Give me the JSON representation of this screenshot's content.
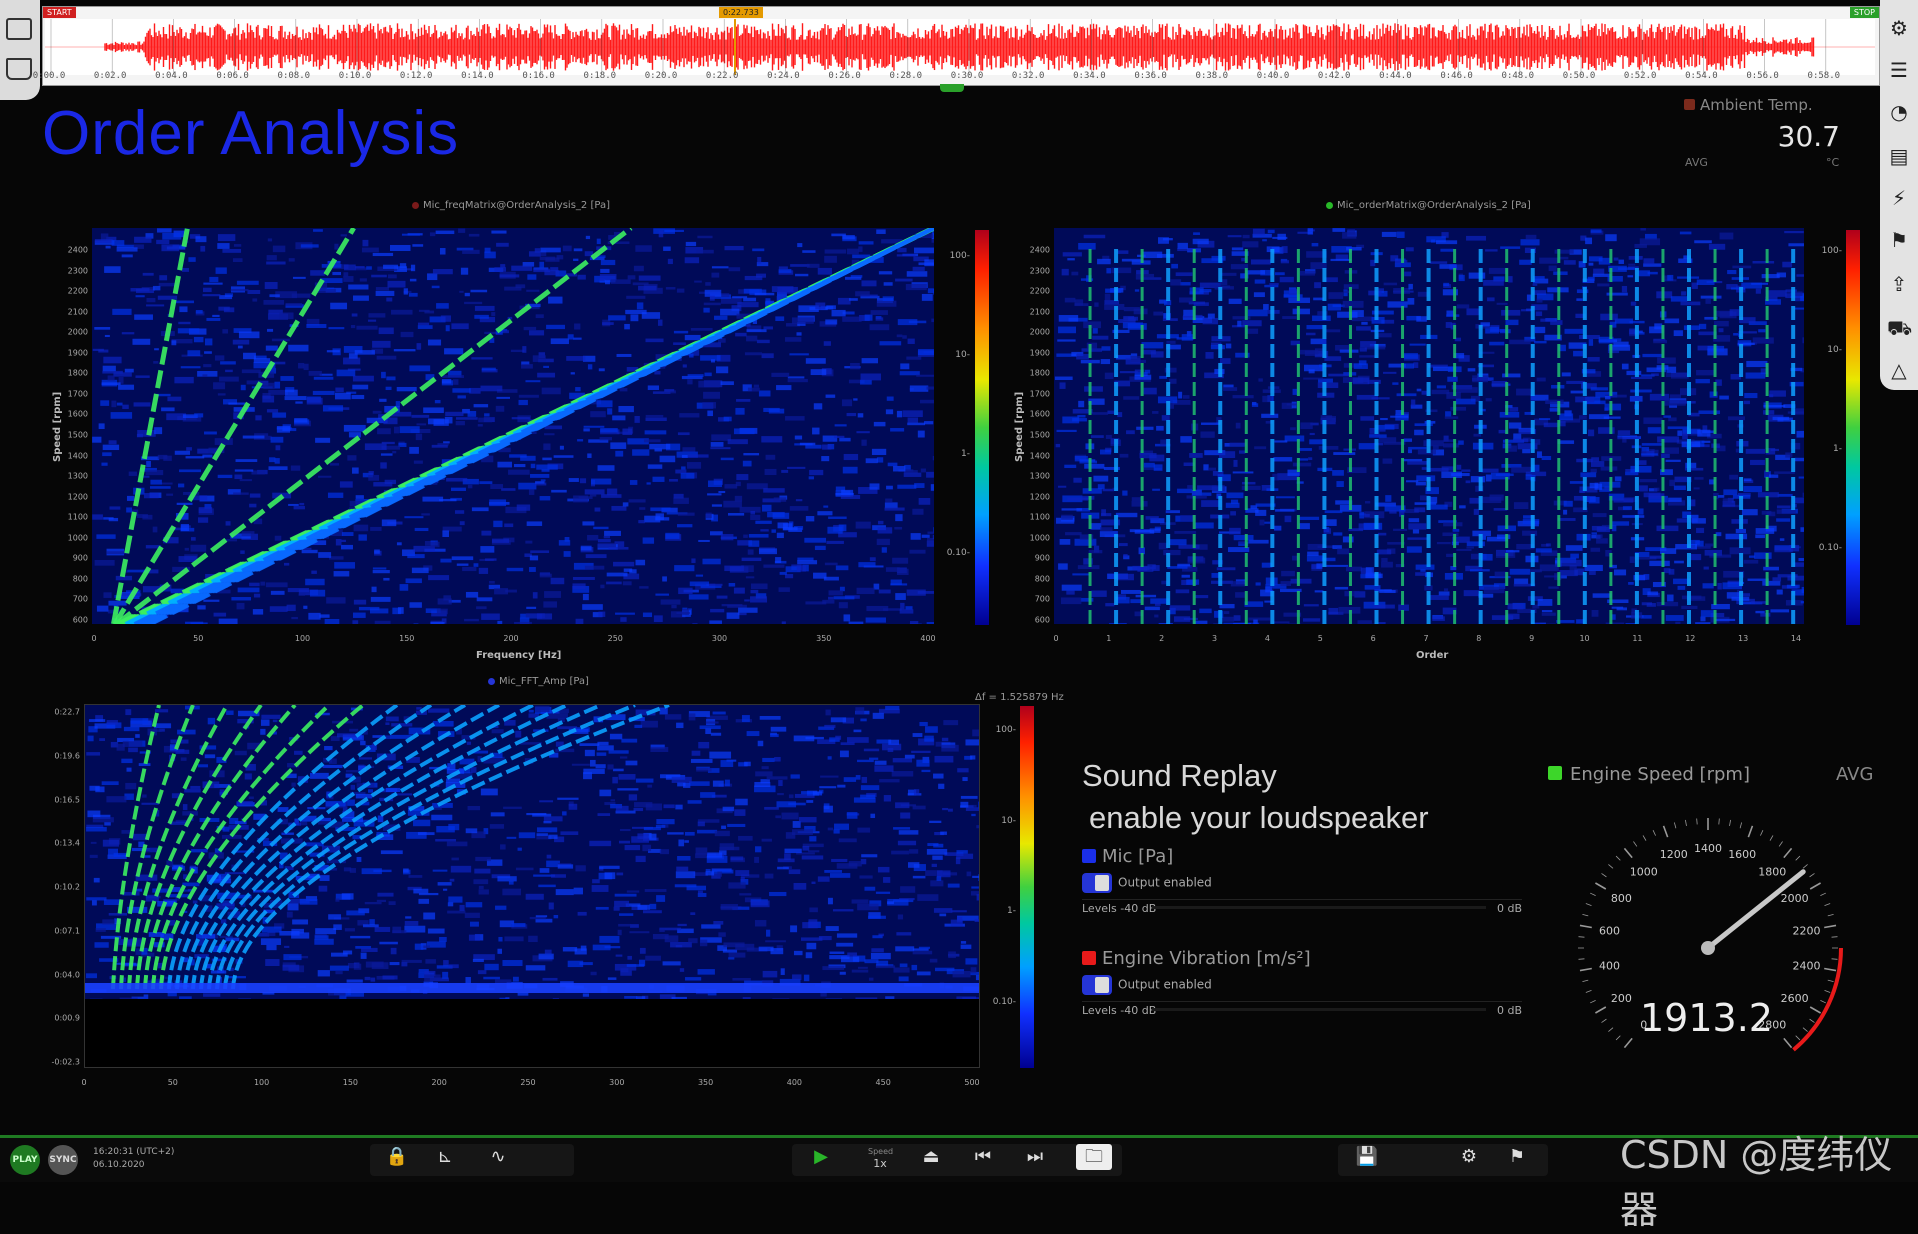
{
  "waveform": {
    "start_marker": "START",
    "stop_marker": "STOP",
    "cursor_time": "0:22.733",
    "time_ticks": [
      "0:00.0",
      "0:02.0",
      "0:04.0",
      "0:06.0",
      "0:08.0",
      "0:10.0",
      "0:12.0",
      "0:14.0",
      "0:16.0",
      "0:18.0",
      "0:20.0",
      "0:22.0",
      "0:24.0",
      "0:26.0",
      "0:28.0",
      "0:30.0",
      "0:32.0",
      "0:34.0",
      "0:36.0",
      "0:38.0",
      "0:40.0",
      "0:42.0",
      "0:44.0",
      "0:46.0",
      "0:48.0",
      "0:50.0",
      "0:52.0",
      "0:54.0",
      "0:56.0",
      "0:58.0"
    ],
    "color": "#ff1a1a"
  },
  "header": {
    "title": "Order Analysis",
    "ambient": {
      "label": "Ambient Temp.",
      "value": "30.7",
      "mode": "AVG",
      "unit": "°C",
      "color": "#7b2a1c"
    }
  },
  "plots": {
    "freq_matrix": {
      "title": "Mic_freqMatrix@OrderAnalysis_2 [Pa]",
      "dot_color": "#7a1a1a",
      "ylabel": "Speed [rpm]",
      "xlabel": "Frequency [Hz]",
      "yticks": [
        "2400",
        "2300",
        "2200",
        "2100",
        "2000",
        "1900",
        "1800",
        "1700",
        "1600",
        "1500",
        "1400",
        "1300",
        "1200",
        "1100",
        "1000",
        "900",
        "800",
        "700",
        "600"
      ],
      "xticks": [
        "0",
        "50",
        "100",
        "150",
        "200",
        "250",
        "300",
        "350",
        "400"
      ],
      "cbticks": [
        "100-",
        "10-",
        "1-",
        "0.10-"
      ]
    },
    "order_matrix": {
      "title": "Mic_orderMatrix@OrderAnalysis_2 [Pa]",
      "dot_color": "#28b828",
      "ylabel": "Speed [rpm]",
      "xlabel": "Order",
      "yticks": [
        "2400",
        "2300",
        "2200",
        "2100",
        "2000",
        "1900",
        "1800",
        "1700",
        "1600",
        "1500",
        "1400",
        "1300",
        "1200",
        "1100",
        "1000",
        "900",
        "800",
        "700",
        "600"
      ],
      "xticks": [
        "0",
        "1",
        "2",
        "3",
        "4",
        "5",
        "6",
        "7",
        "8",
        "9",
        "10",
        "11",
        "12",
        "13",
        "14"
      ],
      "cbticks": [
        "100-",
        "10-",
        "1-",
        "0.10-"
      ]
    },
    "fft_amp": {
      "title": "Mic_FFT_Amp [Pa]",
      "dot_color": "#2535d6",
      "resolution": "Δf = 1.525879 Hz",
      "yticks": [
        "0:22.7",
        "0:19.6",
        "0:16.5",
        "0:13.4",
        "0:10.2",
        "0:07.1",
        "0:04.0",
        "0:00.9",
        "-0:02.3"
      ],
      "xticks": [
        "0",
        "50",
        "100",
        "150",
        "200",
        "250",
        "300",
        "350",
        "400",
        "450",
        "500"
      ],
      "cbticks": [
        "100-",
        "10-",
        "1-",
        "0.10-"
      ]
    }
  },
  "sound_replay": {
    "title": "Sound Replay",
    "subtitle": "enable your loudspeaker",
    "channels": [
      {
        "name": "Mic [Pa]",
        "color": "#1a2ee8",
        "output": "Output enabled",
        "levels_left": "Levels -40 dB",
        "levels_right": "0 dB"
      },
      {
        "name": "Engine Vibration [m/s²]",
        "color": "#e81a1a",
        "output": "Output enabled",
        "levels_left": "Levels -40 dB",
        "levels_right": "0 dB"
      }
    ]
  },
  "gauge": {
    "title": "Engine Speed [rpm]",
    "mode": "AVG",
    "value": "1913.2",
    "value_num": 1913.2,
    "min": 0,
    "max": 2800,
    "ticks": [
      "0",
      "200",
      "400",
      "600",
      "800",
      "1000",
      "1200",
      "1400",
      "1600",
      "1800",
      "2000",
      "2200",
      "2400",
      "2600",
      "2800"
    ],
    "redline_from": 2300,
    "color": "#3dd62a"
  },
  "bottom": {
    "play_label": "PLAY",
    "sync_label": "SYNC",
    "time": "16:20:31 (UTC+2)",
    "date": "06.10.2020",
    "speed_label": "Speed",
    "speed_value": "1x",
    "watermark": "CSDN @度纬仪器"
  },
  "icons": {
    "left": [
      "windows-icon",
      "print-icon"
    ],
    "right": [
      "settings-icon",
      "list-icon",
      "dashboard-icon",
      "report-icon",
      "flash-icon",
      "flag-icon",
      "export-icon",
      "car-icon",
      "warning-icon"
    ],
    "bottom": [
      "lock-icon",
      "measure-icon",
      "waveform-icon",
      "play-icon",
      "eject-icon",
      "skip-back-icon",
      "skip-forward-icon",
      "folder-icon",
      "save-icon",
      "settings-cog-icon",
      "flag-icon"
    ]
  }
}
